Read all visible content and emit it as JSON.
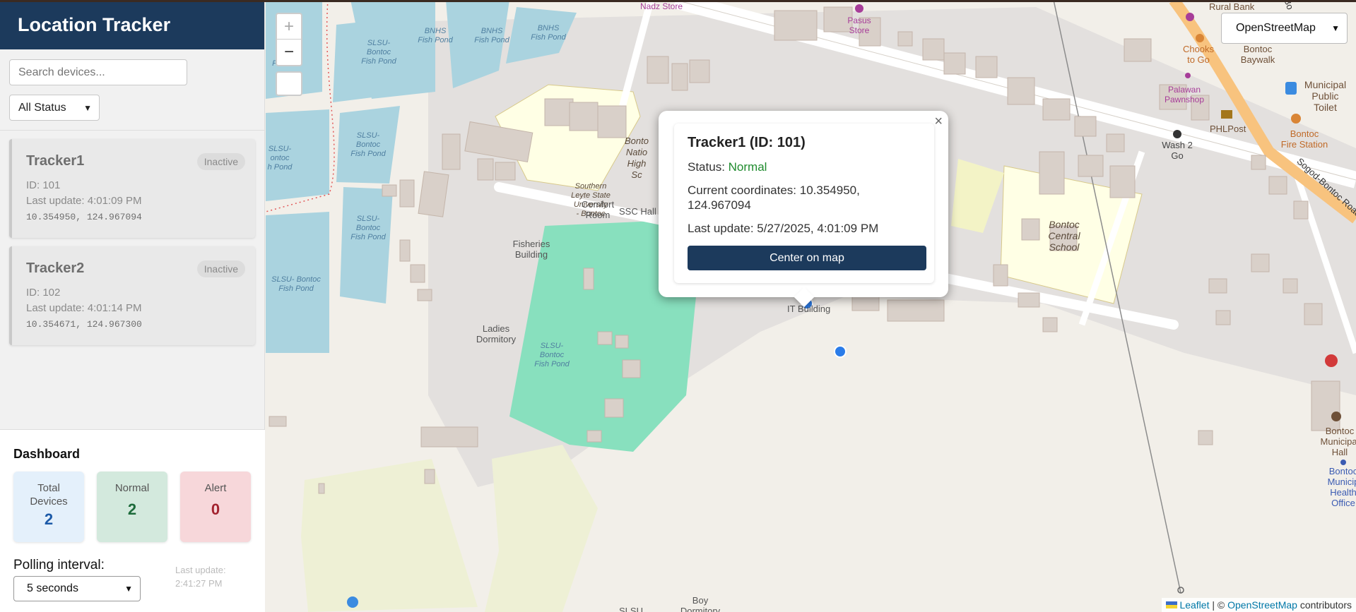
{
  "sidebar": {
    "title": "Location Tracker",
    "search_placeholder": "Search devices...",
    "status_filter": "All Status",
    "devices": [
      {
        "name": "Tracker1",
        "status": "Inactive",
        "id": "ID: 101",
        "last_update": "Last update: 4:01:09 PM",
        "coords": "10.354950, 124.967094"
      },
      {
        "name": "Tracker2",
        "status": "Inactive",
        "id": "ID: 102",
        "last_update": "Last update: 4:01:14 PM",
        "coords": "10.354671, 124.967300"
      }
    ]
  },
  "dashboard": {
    "title": "Dashboard",
    "total_label_1": "Total",
    "total_label_2": "Devices",
    "total_value": "2",
    "normal_label": "Normal",
    "normal_value": "2",
    "alert_label": "Alert",
    "alert_value": "0",
    "polling_label": "Polling interval:",
    "polling_value": "5 seconds",
    "last_update_label": "Last update:",
    "last_update_value": "2:41:27 PM"
  },
  "map": {
    "zoom_in": "+",
    "zoom_out": "−",
    "layer": "OpenStreetMap",
    "attribution_leaflet": "Leaflet",
    "attribution_sep": " | © ",
    "attribution_osm": "OpenStreetMap",
    "attribution_tail": " contributors",
    "labels": {
      "nadz_store": "Nadz Store",
      "pasus_store_1": "Pasus",
      "pasus_store_2": "Store",
      "bnhs_fish_pond_a_1": "BNHS",
      "bnhs_fish_pond_a_2": "Fish Pond",
      "bnhs_fish_pond_b_1": "BNHS",
      "bnhs_fish_pond_b_2": "Fish Pond",
      "bnhs_fish_pond_c_1": "BNHS",
      "bnhs_fish_pond_c_2": "Fish Pond",
      "slsu_pond_1_1": "SLSU-",
      "slsu_pond_1_2": "Bontoc",
      "slsu_pond_1_3": "Fish Pond",
      "slsu_pond_2_1": "SLSU-",
      "slsu_pond_2_2": "Bontoc",
      "slsu_pond_2_3": "Fish Pond",
      "slsu_pond_3_1": "SLSU-",
      "slsu_pond_3_2": "Bontoc",
      "slsu_pond_3_3": "Fish Pond",
      "slsu_pond_4_1": "SLSU-",
      "slsu_pond_4_2": "ontoc",
      "slsu_pond_4_3": "h Pond",
      "slsu_pond_5_1": "SLSU- Bontoc",
      "slsu_pond_5_2": "Fish Pond",
      "slsu_pond_6_1": "SLSU-",
      "slsu_pond_6_2": "Bontoc",
      "slsu_pond_6_3": "Fish Pond",
      "pond_top_left": "Pond",
      "bontoc_nhs_1": "Bonto",
      "bontoc_nhs_2": "Natio",
      "bontoc_nhs_3": "High Sc",
      "slsu_bontoc_1": "Southern",
      "slsu_bontoc_2": "Leyte State",
      "slsu_bontoc_3": "University",
      "slsu_bontoc_4": "- Bontoc",
      "ssc_hall": "SSC Hall",
      "comfort_room_1": "Comfort",
      "comfort_room_2": "Room",
      "fisheries_1": "Fisheries",
      "fisheries_2": "Building",
      "ladies_dorm_1": "Ladies",
      "ladies_dorm_2": "Dormitory",
      "it_building": "IT Building",
      "bontoc_central_1": "Bontoc",
      "bontoc_central_2": "Central",
      "bontoc_central_3": "School",
      "rural_bank": "Rural Bank",
      "chooks_1": "Chooks",
      "chooks_2": "to Go",
      "palawan_1": "Palawan",
      "palawan_2": "Pawnshop",
      "phlpost": "PHLPost",
      "wash2go_1": "Wash 2",
      "wash2go_2": "Go",
      "baywalk_1": "Bontoc",
      "baywalk_2": "Baywalk",
      "toilet_1": "Municipal",
      "toilet_2": "Public",
      "toilet_3": "Toilet",
      "fire_1": "Bontoc",
      "fire_2": "Fire Station",
      "road_sogod": "Sogod-Bontoc Road",
      "road_top": "evard",
      "road_top2": "Bo",
      "muni_hall_1": "Bontoc",
      "muni_hall_2": "Municipal",
      "muni_hall_3": "Hall",
      "health_1": "Bontoc",
      "health_2": "Municip",
      "health_3": "Health",
      "health_4": "Office",
      "boy_dorm_1": "Boy",
      "boy_dorm_2": "Dormitory",
      "slsu_bottom": "SLSU"
    }
  },
  "popup": {
    "close": "×",
    "title": "Tracker1 (ID: 101)",
    "status_label": "Status: ",
    "status_value": "Normal",
    "coords_label": "Current coordinates: 10.354950,",
    "coords_line2": "124.967094",
    "last_update": "Last update: 5/27/2025, 4:01:09 PM",
    "button": "Center on map"
  },
  "colors": {
    "header": "#1c3a5c",
    "water": "#aad3df",
    "building": "#d9d0c9",
    "school": "#ffffe5",
    "landuse": "#e3e0de",
    "grass": "#88e0be",
    "road_major": "#f8c37e",
    "marker": "#2b7ce9"
  }
}
